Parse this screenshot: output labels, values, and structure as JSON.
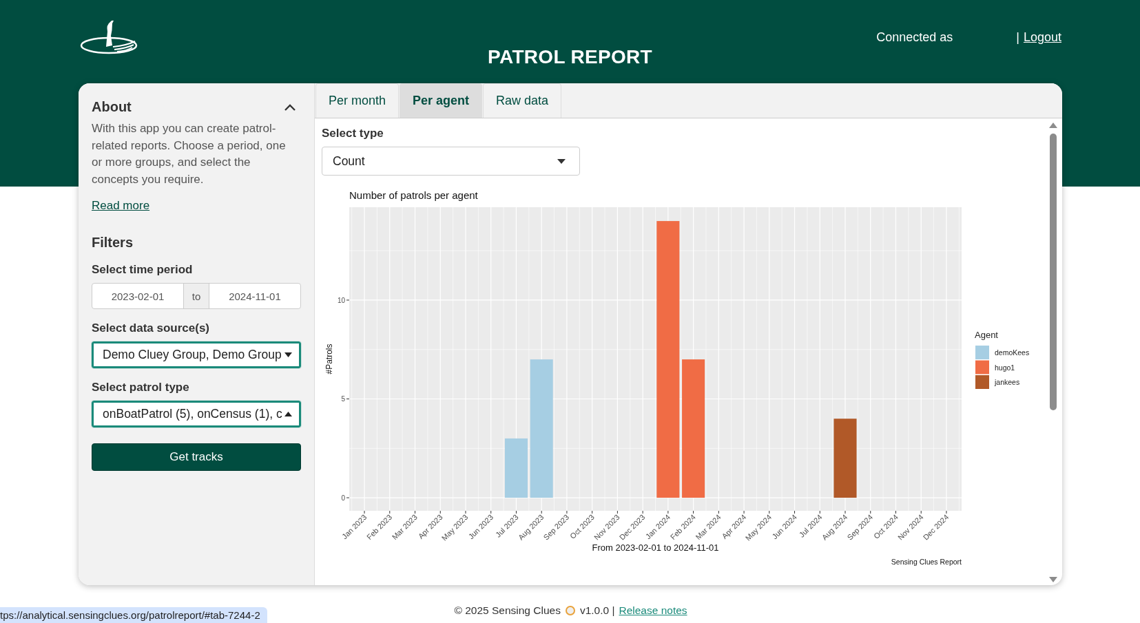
{
  "header": {
    "title": "PATROL REPORT",
    "connected_label": "Connected as",
    "separator": "|",
    "logout": "Logout"
  },
  "sidebar": {
    "about": {
      "title": "About",
      "expanded": true,
      "text": "With this app you can create patrol-related reports. Choose a period, one or more groups, and select the concepts you require.",
      "link": "Read more"
    },
    "filters": {
      "title": "Filters",
      "time_period": {
        "label": "Select time period",
        "start": "2023-02-01",
        "separator": "to",
        "end": "2024-11-01"
      },
      "data_sources": {
        "label": "Select data source(s)",
        "value": "Demo Cluey Group, Demo Group",
        "open": false
      },
      "patrol_type": {
        "label": "Select patrol type",
        "value": "onBoatPatrol (5), onCensus (1), c",
        "open": true
      },
      "button": "Get tracks"
    }
  },
  "tabs": [
    {
      "label": "Per month",
      "selected": false
    },
    {
      "label": "Per agent",
      "selected": true
    },
    {
      "label": "Raw data",
      "selected": false
    }
  ],
  "panel": {
    "select_type": {
      "label": "Select type",
      "value": "Count"
    },
    "chart_caption": "Sensing Clues Report",
    "chart_data": {
      "type": "bar",
      "title": "Number of patrols per agent",
      "xlabel": "From 2023-02-01 to 2024-11-01",
      "ylabel": "#Patrols",
      "categories": [
        "Jan 2023",
        "Feb 2023",
        "Mar 2023",
        "Apr 2023",
        "May 2023",
        "Jun 2023",
        "Jul 2023",
        "Aug 2023",
        "Sep 2023",
        "Oct 2023",
        "Nov 2023",
        "Dec 2023",
        "Jan 2024",
        "Feb 2024",
        "Mar 2024",
        "Apr 2024",
        "May 2024",
        "Jun 2024",
        "Jul 2024",
        "Aug 2024",
        "Sep 2024",
        "Oct 2024",
        "Nov 2024",
        "Dec 2024"
      ],
      "series": [
        {
          "name": "demoKees",
          "color": "#a6cee3",
          "values": [
            null,
            null,
            null,
            null,
            null,
            null,
            3,
            7,
            null,
            null,
            null,
            null,
            null,
            null,
            null,
            null,
            null,
            null,
            null,
            null,
            null,
            null,
            null,
            null
          ]
        },
        {
          "name": "hugo1",
          "color": "#f06c45",
          "values": [
            null,
            null,
            null,
            null,
            null,
            null,
            null,
            null,
            null,
            null,
            null,
            null,
            14,
            7,
            null,
            null,
            null,
            null,
            null,
            null,
            null,
            null,
            null,
            null
          ]
        },
        {
          "name": "jankees",
          "color": "#b15928",
          "values": [
            null,
            null,
            null,
            null,
            null,
            null,
            null,
            null,
            null,
            null,
            null,
            null,
            null,
            null,
            null,
            null,
            null,
            null,
            null,
            4,
            null,
            null,
            null,
            null
          ]
        }
      ],
      "ylim": [
        -0.66,
        14.7
      ],
      "yticks": [
        0,
        5,
        10
      ],
      "stacked": true,
      "grid": true,
      "legend": {
        "title": "Agent"
      }
    }
  },
  "footer": {
    "copyright": "© 2025 Sensing Clues",
    "version": "v1.0.0 |",
    "link": "Release notes"
  },
  "status_bar": {
    "url": "tps://analytical.sensingclues.org/patrolreport/#tab-7244-2"
  }
}
